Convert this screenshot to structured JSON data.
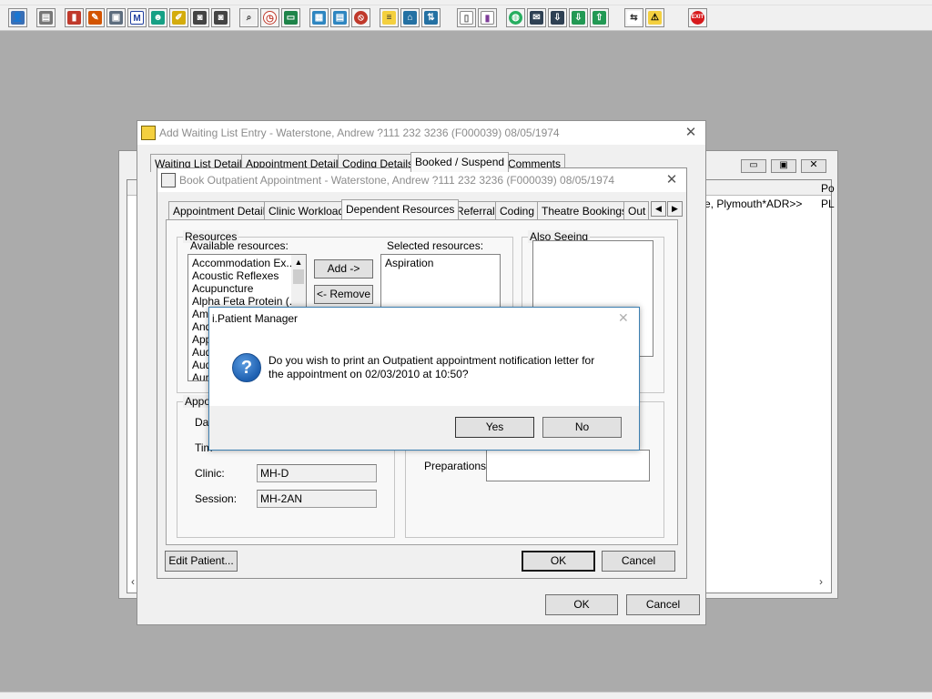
{
  "toolbar": {
    "icons": [
      "patient-icon",
      "print-icon",
      "book-icon",
      "notes-icon",
      "scanner-icon",
      "m-icon",
      "person-icon",
      "edit-icon",
      "camera-icon",
      "camera2-icon",
      "search-icon",
      "clock-icon",
      "screen-icon",
      "chart-icon",
      "monitor-icon",
      "stop-icon",
      "note-icon",
      "bed-icon",
      "transfer-icon",
      "document-icon",
      "bar-chart-icon",
      "globe-icon",
      "letter-icon",
      "inbox-icon",
      "outbox-icon",
      "swap-icon",
      "warning-icon",
      "exit-icon"
    ],
    "exit_label": "EXIT"
  },
  "back_window": {
    "list_cell_1": "e, Plymouth*ADR>>",
    "list_cell_2": "PL",
    "header_cell": "Po"
  },
  "waiting_list_window": {
    "title": "Add Waiting List Entry - Waterstone, Andrew ?111 232 3236 (F000039) 08/05/1974",
    "tabs": [
      "Waiting List Details",
      "Appointment Details",
      "Coding Details",
      "Booked / Suspend",
      "Comments"
    ],
    "active_tab_index": 3,
    "ok_label": "OK",
    "cancel_label": "Cancel"
  },
  "book_window": {
    "title": "Book Outpatient Appointment - Waterstone, Andrew ?111 232 3236 (F000039) 08/05/1974",
    "tabs": [
      "Appointment Details",
      "Clinic Workload",
      "Dependent Resources",
      "Referral",
      "Coding",
      "Theatre Bookings",
      "Out"
    ],
    "active_tab_index": 2,
    "resources_legend": "Resources",
    "available_label": "Available resources:",
    "selected_label": "Selected resources:",
    "available_items": [
      "Accommodation Ex...",
      "Acoustic Reflexes",
      "Acupuncture",
      "Alpha Feta Protein (...",
      "Aml",
      "And",
      "App",
      "Aud",
      "Aud",
      "Aur"
    ],
    "selected_items": [
      "Aspiration"
    ],
    "add_label": "Add ->",
    "remove_label": "<- Remove",
    "also_seeing_legend": "Also Seeing",
    "appointment_legend": "Appo",
    "date_label": "Da",
    "time_label": "Tim",
    "clinic_label": "Clinic:",
    "clinic_value": "MH-D",
    "session_label": "Session:",
    "session_value": "MH-2AN",
    "preparations_label": "Preparations:",
    "preparations_value": "",
    "edit_patient_label": "Edit Patient...",
    "ok_label": "OK",
    "cancel_label": "Cancel"
  },
  "dialog": {
    "title": "i.Patient Manager",
    "message_line1": "Do you wish to print an Outpatient appointment notification letter for",
    "message_line2": "the appointment on 02/03/2010 at 10:50?",
    "yes_label": "Yes",
    "no_label": "No"
  },
  "colors": {
    "desktop": "#ababab",
    "dialog_border": "#3c7fb1",
    "question_icon": "#1d5fb0"
  }
}
